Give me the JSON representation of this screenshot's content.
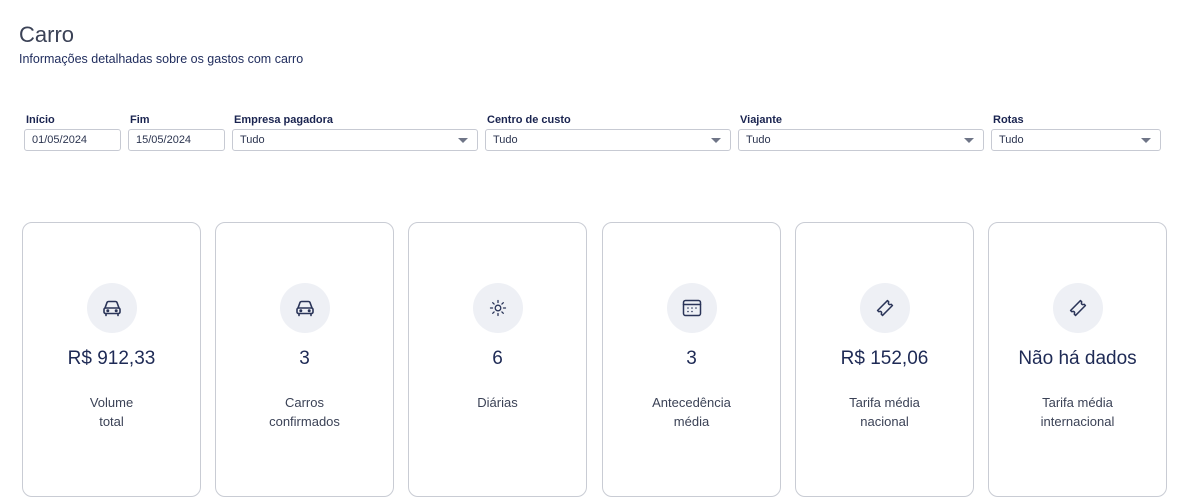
{
  "header": {
    "title": "Carro",
    "subtitle": "Informações detalhadas sobre os gastos com carro"
  },
  "filters": {
    "inicio": {
      "label": "Início",
      "value": "01/05/2024"
    },
    "fim": {
      "label": "Fim",
      "value": "15/05/2024"
    },
    "empresa": {
      "label": "Empresa pagadora",
      "value": "Tudo"
    },
    "centro": {
      "label": "Centro de custo",
      "value": "Tudo"
    },
    "viajante": {
      "label": "Viajante",
      "value": "Tudo"
    },
    "rotas": {
      "label": "Rotas",
      "value": "Tudo"
    }
  },
  "cards": [
    {
      "icon": "car-icon",
      "value": "R$ 912,33",
      "label_line1": "Volume",
      "label_line2": "total"
    },
    {
      "icon": "car-icon",
      "value": "3",
      "label_line1": "Carros",
      "label_line2": "confirmados"
    },
    {
      "icon": "sun-icon",
      "value": "6",
      "label_line1": "Diárias",
      "label_line2": ""
    },
    {
      "icon": "calendar-icon",
      "value": "3",
      "label_line1": "Antecedência",
      "label_line2": "média"
    },
    {
      "icon": "ticket-icon",
      "value": "R$ 152,06",
      "label_line1": "Tarifa média",
      "label_line2": "nacional"
    },
    {
      "icon": "ticket-icon",
      "value": "Não há dados",
      "label_line1": "Tarifa média",
      "label_line2": "internacional"
    }
  ],
  "colors": {
    "text_primary": "#1e2a55",
    "border": "#c9ccd4",
    "icon_bg": "#eef0f5"
  }
}
